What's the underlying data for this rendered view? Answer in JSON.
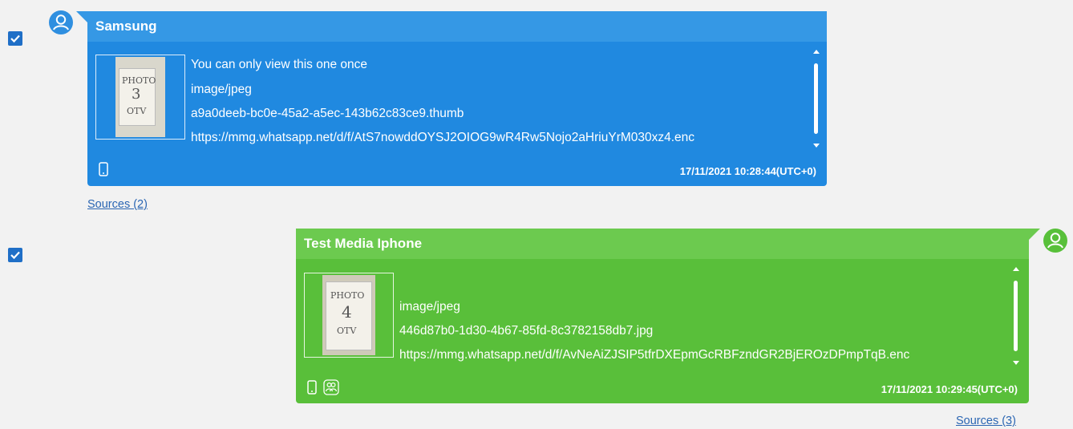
{
  "colors": {
    "incoming_body": "#2089e0",
    "incoming_header": "#3598e5",
    "outgoing_body": "#59bf3a",
    "outgoing_header": "#6cca4f",
    "checkbox": "#1f6fc7",
    "avatar_incoming": "#2f8fe0",
    "avatar_outgoing": "#58c03a",
    "link": "#2b66b3"
  },
  "messages": [
    {
      "sender": "Samsung",
      "direction": "incoming",
      "checked": true,
      "thumbnail_text": "PHOTO 3 OTV",
      "lines": [
        "You can only view this one once",
        "image/jpeg",
        "a9a0deeb-bc0e-45a2-a5ec-143b62c83ce9.thumb",
        "https://mmg.whatsapp.net/d/f/AtS7nowddOYSJ2OIOG9wR4Rw5Nojo2aHriuYrM030xz4.enc"
      ],
      "timestamp": "17/11/2021 10:28:44(UTC+0)",
      "footer_icons": [
        "phone-icon"
      ],
      "sources_label": "Sources (2)"
    },
    {
      "sender": "Test Media Iphone",
      "direction": "outgoing",
      "checked": true,
      "thumbnail_text": "PHOTO 4 OTV",
      "lines": [
        "image/jpeg",
        "446d87b0-1d30-4b67-85fd-8c3782158db7.jpg",
        "https://mmg.whatsapp.net/d/f/AvNeAiZJSIP5tfrDXEpmGcRBFzndGR2BjEROzDPmpTqB.enc"
      ],
      "timestamp": "17/11/2021 10:29:45(UTC+0)",
      "footer_icons": [
        "phone-icon",
        "group-icon"
      ],
      "sources_label": "Sources (3)"
    }
  ]
}
